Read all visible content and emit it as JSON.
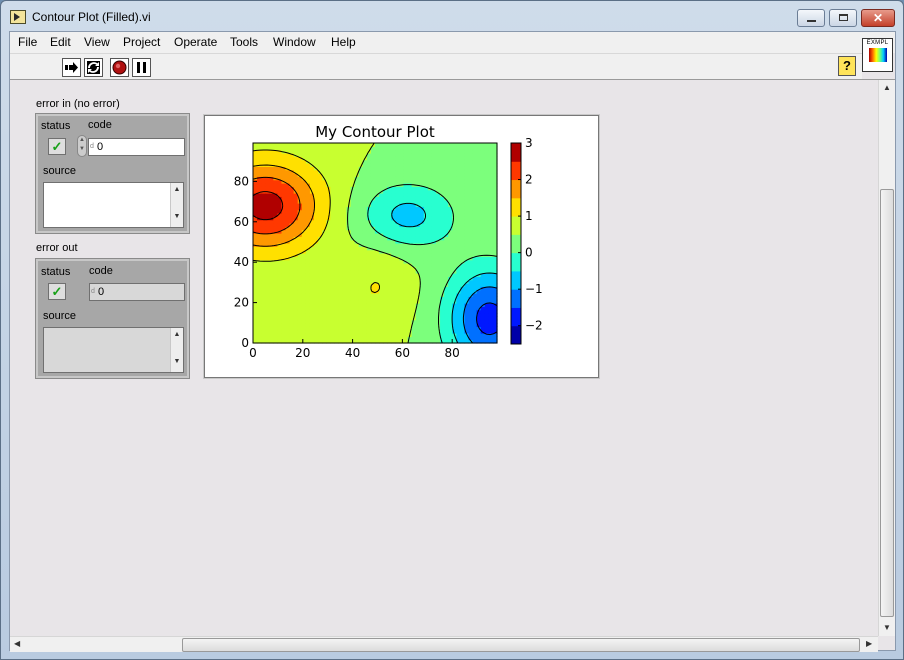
{
  "window": {
    "title": "Contour Plot (Filled).vi"
  },
  "menu": {
    "items": [
      "File",
      "Edit",
      "View",
      "Project",
      "Operate",
      "Tools",
      "Window",
      "Help"
    ]
  },
  "toolbar": {
    "help_label": "?",
    "icon_label": "EXMPL"
  },
  "error_in": {
    "label": "error in (no error)",
    "status_label": "status",
    "code_label": "code",
    "code_value": "0",
    "source_label": "source",
    "source_value": ""
  },
  "error_out": {
    "label": "error out",
    "status_label": "status",
    "code_label": "code",
    "code_value": "0",
    "source_label": "source",
    "source_value": ""
  },
  "colors": {
    "panel": "#e8e5e8",
    "cluster": "#a7a7a7"
  },
  "chart_data": {
    "type": "heatmap",
    "title": "My Contour Plot",
    "xlim": [
      0,
      98
    ],
    "ylim": [
      0,
      99
    ],
    "xticks": [
      0,
      20,
      40,
      60,
      80
    ],
    "yticks": [
      0,
      20,
      40,
      60,
      80
    ],
    "colorbar_ticks": [
      3,
      2,
      1,
      0,
      -1,
      -2
    ],
    "colorbar_tick_labels": [
      "3",
      "2",
      "1",
      "0",
      "−1",
      "−2"
    ],
    "levels": [
      -2.5,
      -2.0,
      -1.5,
      -1.0,
      -0.5,
      0.0,
      0.5,
      1.0,
      1.5,
      2.0,
      2.5,
      3.0
    ],
    "level_colors": [
      "#0000a8",
      "#0018ff",
      "#0070ff",
      "#00c8ff",
      "#28ffd0",
      "#7cff7c",
      "#c8ff30",
      "#ffe000",
      "#ff9800",
      "#ff3800",
      "#b00000"
    ],
    "negative_contours_dashed": true,
    "peaks": [
      {
        "x": 5,
        "y": 68,
        "amp": 2.2,
        "sx": 16,
        "sy": 16
      },
      {
        "x": 30,
        "y": 5,
        "amp": 0.45,
        "sx": 13,
        "sy": 12
      },
      {
        "x": 50,
        "y": 30,
        "amp": 0.5,
        "sx": 10,
        "sy": 14
      },
      {
        "x": 62,
        "y": 63,
        "amp": -1.15,
        "sx": 14,
        "sy": 12
      },
      {
        "x": 95,
        "y": 12,
        "amp": -2.2,
        "sx": 12,
        "sy": 18
      },
      {
        "x": 92,
        "y": 95,
        "amp": -0.45,
        "sx": 7,
        "sy": 6
      }
    ],
    "baseline": 0.5
  }
}
